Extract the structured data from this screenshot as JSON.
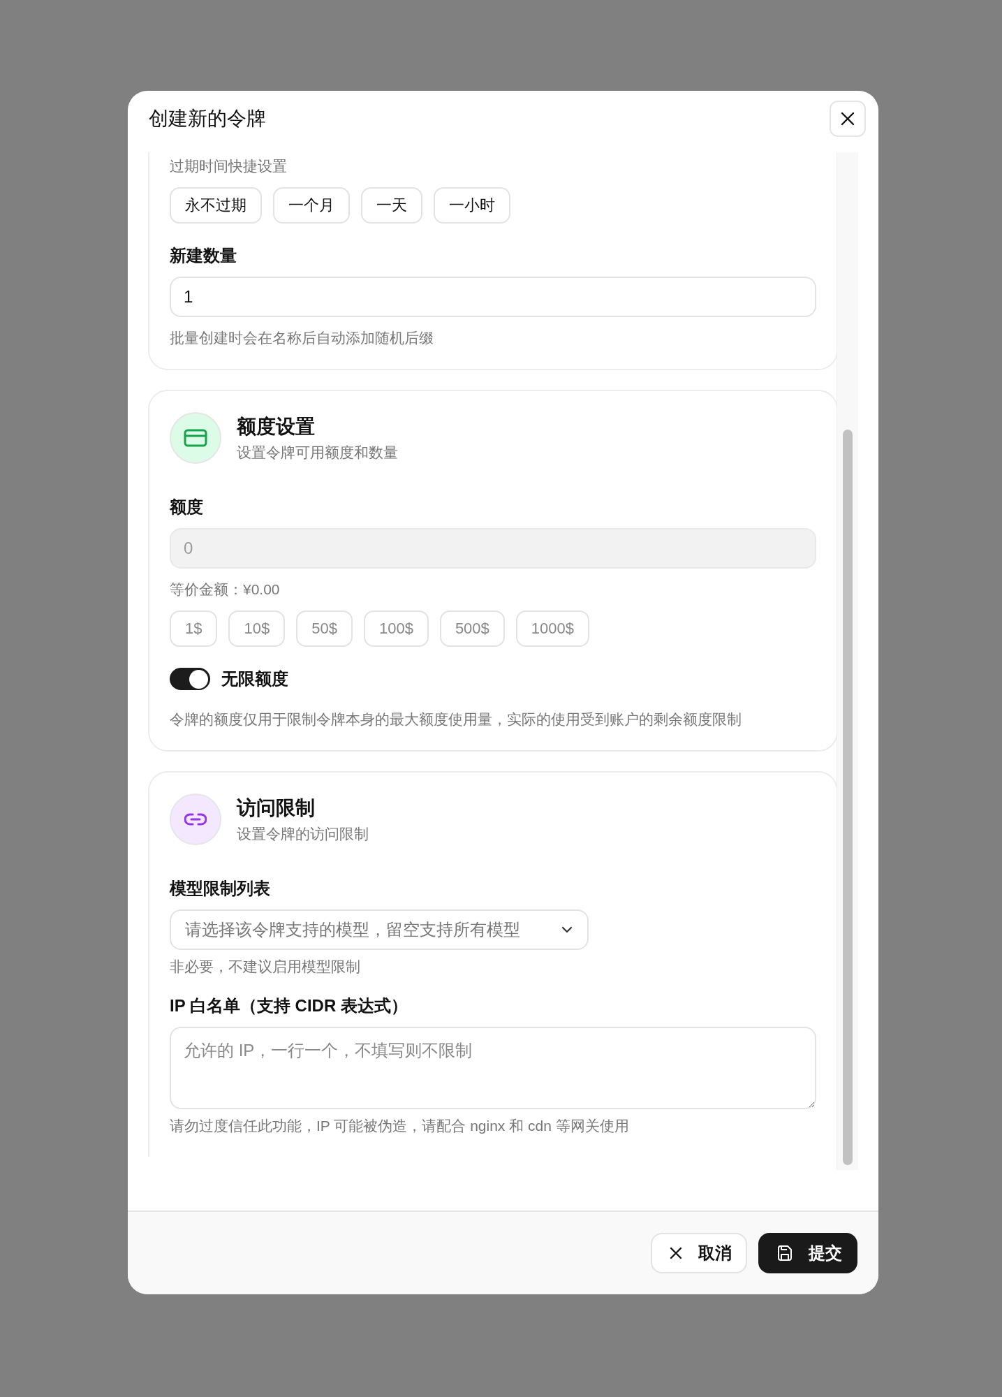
{
  "dialog": {
    "title": "创建新的令牌"
  },
  "expiry_presets": {
    "label": "过期时间快捷设置",
    "buttons": [
      {
        "label": "永不过期"
      },
      {
        "label": "一个月"
      },
      {
        "label": "一天"
      },
      {
        "label": "一小时"
      }
    ]
  },
  "count_field": {
    "label": "新建数量",
    "value": "1",
    "help": "批量创建时会在名称后自动添加随机后缀"
  },
  "quota_section": {
    "title": "额度设置",
    "subtitle": "设置令牌可用额度和数量",
    "quota_field": {
      "label": "额度",
      "placeholder": "0",
      "disabled": true
    },
    "equivalent": "等价金额：¥0.00",
    "presets": [
      {
        "label": "1$",
        "disabled": true
      },
      {
        "label": "10$",
        "disabled": true
      },
      {
        "label": "50$",
        "disabled": true
      },
      {
        "label": "100$",
        "disabled": true
      },
      {
        "label": "500$",
        "disabled": true
      },
      {
        "label": "1000$",
        "disabled": true
      }
    ],
    "unlimited": {
      "label": "无限额度",
      "on": true
    },
    "note": "令牌的额度仅用于限制令牌本身的最大额度使用量，实际的使用受到账户的剩余额度限制"
  },
  "access_section": {
    "title": "访问限制",
    "subtitle": "设置令牌的访问限制",
    "model_select": {
      "label": "模型限制列表",
      "placeholder": "请选择该令牌支持的模型，留空支持所有模型",
      "help": "非必要，不建议启用模型限制"
    },
    "ip_whitelist": {
      "label": "IP 白名单（支持 CIDR 表达式）",
      "placeholder": "允许的 IP，一行一个，不填写则不限制",
      "help": "请勿过度信任此功能，IP 可能被伪造，请配合 nginx 和 cdn 等网关使用"
    }
  },
  "footer": {
    "buttons": [
      {
        "label": "取消",
        "kind": "cancel"
      },
      {
        "label": "提交",
        "kind": "submit"
      }
    ]
  }
}
